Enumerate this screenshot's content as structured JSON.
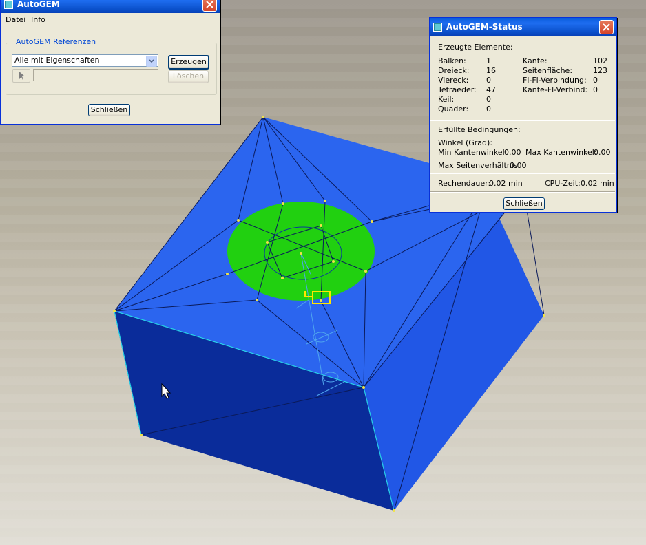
{
  "autogem_window": {
    "title": "AutoGEM",
    "menu": [
      "Datei",
      "Info"
    ],
    "group_label": "AutoGEM Referenzen",
    "dropdown_value": "Alle mit Eigenschaften",
    "buttons": {
      "create": "Erzeugen",
      "delete": "Löschen",
      "close": "Schließen"
    }
  },
  "status_window": {
    "title": "AutoGEM-Status",
    "created_elements_header": "Erzeugte Elemente:",
    "elements_left": [
      {
        "label": "Balken:",
        "value": "1"
      },
      {
        "label": "Dreieck:",
        "value": "16"
      },
      {
        "label": "Viereck:",
        "value": "0"
      },
      {
        "label": "Tetraeder:",
        "value": "47"
      },
      {
        "label": "Keil:",
        "value": "0"
      },
      {
        "label": "Quader:",
        "value": "0"
      }
    ],
    "elements_right": [
      {
        "label": "Kante:",
        "value": "102"
      },
      {
        "label": "Seitenfläche:",
        "value": "123"
      },
      {
        "label": "Fl-Fl-Verbindung:",
        "value": "0"
      },
      {
        "label": "Kante-Fl-Verbind:",
        "value": "0"
      }
    ],
    "conditions_header": "Erfüllte Bedingungen:",
    "angle_label": "Winkel (Grad):",
    "min_edge_angle_label": "Min Kantenwinkel:",
    "min_edge_angle_value": "0.00",
    "max_edge_angle_label": "Max Kantenwinkel:",
    "max_edge_angle_value": "0.00",
    "max_aspect_label": "Max Seitenverhältnis:",
    "max_aspect_value": "0.00",
    "runtime_label": "Rechendauer:",
    "runtime_value": "0.02 min",
    "cpu_label": "CPU-Zeit:",
    "cpu_value": "0.02 min",
    "close_label": "Schließen"
  },
  "model": {
    "top_face_color": "#2b65ef",
    "left_face_color": "#0a2c9a",
    "right_face_color": "#2157e6",
    "circle_color": "#21d010",
    "edge_highlight_color": "#27d4e8"
  }
}
